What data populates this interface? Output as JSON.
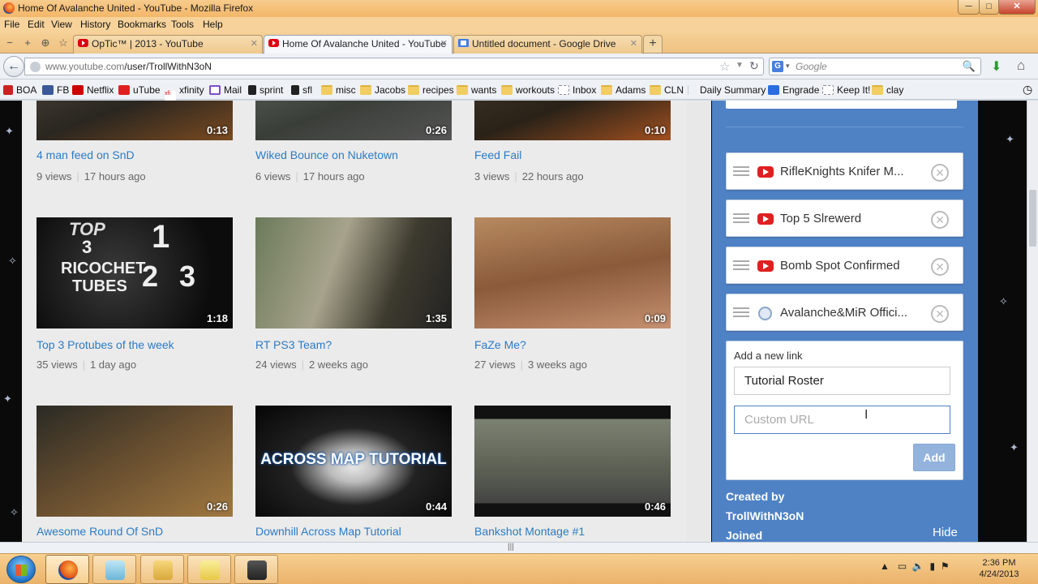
{
  "window": {
    "title": "Home Of Avalanche United - YouTube - Mozilla Firefox",
    "minimize": "─",
    "maximize": "□",
    "close": "✕"
  },
  "menu": [
    "File",
    "Edit",
    "View",
    "History",
    "Bookmarks",
    "Tools",
    "Help"
  ],
  "tabs": [
    {
      "label": "OpTic™ | 2013 - YouTube",
      "icon": "youtube-icon"
    },
    {
      "label": "Home Of Avalanche United - YouTube",
      "icon": "youtube-icon"
    },
    {
      "label": "Untitled document - Google Drive",
      "icon": "google-docs-icon"
    }
  ],
  "address": {
    "host": "www.youtube.com",
    "path": "/user/TrollWithN3oN"
  },
  "search": {
    "placeholder": "Google",
    "engine": "G"
  },
  "bookmarks": [
    "BOA",
    "FB",
    "Netflix",
    "uTube",
    "xfinity",
    "Mail",
    "sprint",
    "sfl",
    "misc",
    "Jacobs",
    "recipes",
    "wants",
    "workouts",
    "Inbox",
    "Adams",
    "CLN",
    "Daily Summary",
    "Engrade",
    "Keep It!",
    "clay"
  ],
  "videos": [
    {
      "duration": "0:13",
      "title": "4 man feed on SnD",
      "views": "9 views",
      "age": "17 hours ago"
    },
    {
      "duration": "0:26",
      "title": "Wiked Bounce on Nuketown",
      "views": "6 views",
      "age": "17 hours ago"
    },
    {
      "duration": "0:10",
      "title": "Feed Fail",
      "views": "3 views",
      "age": "22 hours ago"
    },
    {
      "duration": "1:18",
      "title": "Top 3 Protubes of the week",
      "views": "35 views",
      "age": "1 day ago",
      "thumb_text": [
        "TOP",
        "3",
        "1",
        "RICOCHET",
        "TUBES",
        "2",
        "3"
      ]
    },
    {
      "duration": "1:35",
      "title": "RT PS3 Team?",
      "views": "24 views",
      "age": "2 weeks ago"
    },
    {
      "duration": "0:09",
      "title": "FaZe Me?",
      "views": "27 views",
      "age": "3 weeks ago"
    },
    {
      "duration": "0:26",
      "title": "Awesome Round Of SnD",
      "views": "",
      "age": ""
    },
    {
      "duration": "0:44",
      "title": "Downhill Across Map Tutorial",
      "views": "",
      "age": "",
      "thumb_text": [
        "ACROSS MAP TUTORIAL"
      ]
    },
    {
      "duration": "0:46",
      "title": "Bankshot Montage #1",
      "views": "",
      "age": ""
    }
  ],
  "sidebar": {
    "links": [
      {
        "label": "RifleKnights Knifer M...",
        "icon": "youtube-icon"
      },
      {
        "label": "Top 5 Slrewerd",
        "icon": "youtube-icon"
      },
      {
        "label": "Bomb Spot Confirmed",
        "icon": "youtube-icon"
      },
      {
        "label": "Avalanche&MiR Offici...",
        "icon": "globe-icon"
      }
    ],
    "add_link": {
      "heading": "Add a new link",
      "title_value": "Tutorial Roster",
      "url_placeholder": "Custom URL",
      "add_button": "Add"
    },
    "created_by_label": "Created by",
    "creator": "TrollWithN3oN",
    "joined_label": "Joined",
    "hide": "Hide"
  },
  "taskbar": {
    "time": "2:36 PM",
    "date": "4/24/2013"
  },
  "colors": {
    "sidebar": "#4f82c5",
    "link": "#2b7bc5",
    "titlebar": "#f3b768"
  }
}
